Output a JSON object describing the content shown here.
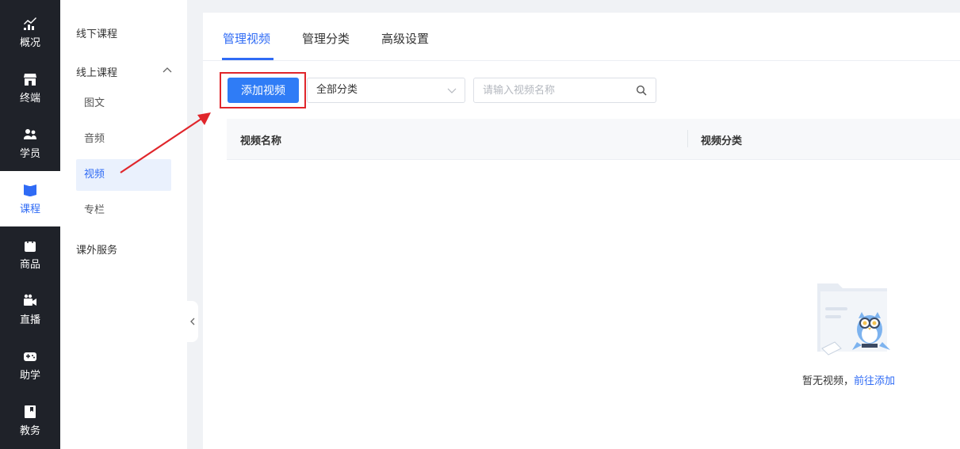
{
  "rail": {
    "items": [
      {
        "label": "概况",
        "icon": "chart-line-icon"
      },
      {
        "label": "终端",
        "icon": "store-icon"
      },
      {
        "label": "学员",
        "icon": "users-icon"
      },
      {
        "label": "课程",
        "icon": "book-icon"
      },
      {
        "label": "商品",
        "icon": "bag-icon"
      },
      {
        "label": "直播",
        "icon": "video-camera-icon"
      },
      {
        "label": "助学",
        "icon": "gamepad-icon"
      },
      {
        "label": "教务",
        "icon": "bookmark-icon"
      }
    ],
    "active_index": 3
  },
  "subnav": {
    "offline": "线下课程",
    "online": "线上课程",
    "children": [
      "图文",
      "音频",
      "视频",
      "专栏"
    ],
    "active_child": "视频",
    "extra": "课外服务"
  },
  "tabs": [
    "管理视频",
    "管理分类",
    "高级设置"
  ],
  "toolbar": {
    "add_label": "添加视频",
    "category_select": "全部分类",
    "search_placeholder": "请输入视频名称"
  },
  "table": {
    "columns": [
      "视频名称",
      "视频分类"
    ]
  },
  "empty": {
    "text": "暂无视频，",
    "link": "前往添加"
  },
  "colors": {
    "accent": "#2f6bf5",
    "rail_bg": "#1f2229",
    "highlight_red": "#e0262b"
  }
}
